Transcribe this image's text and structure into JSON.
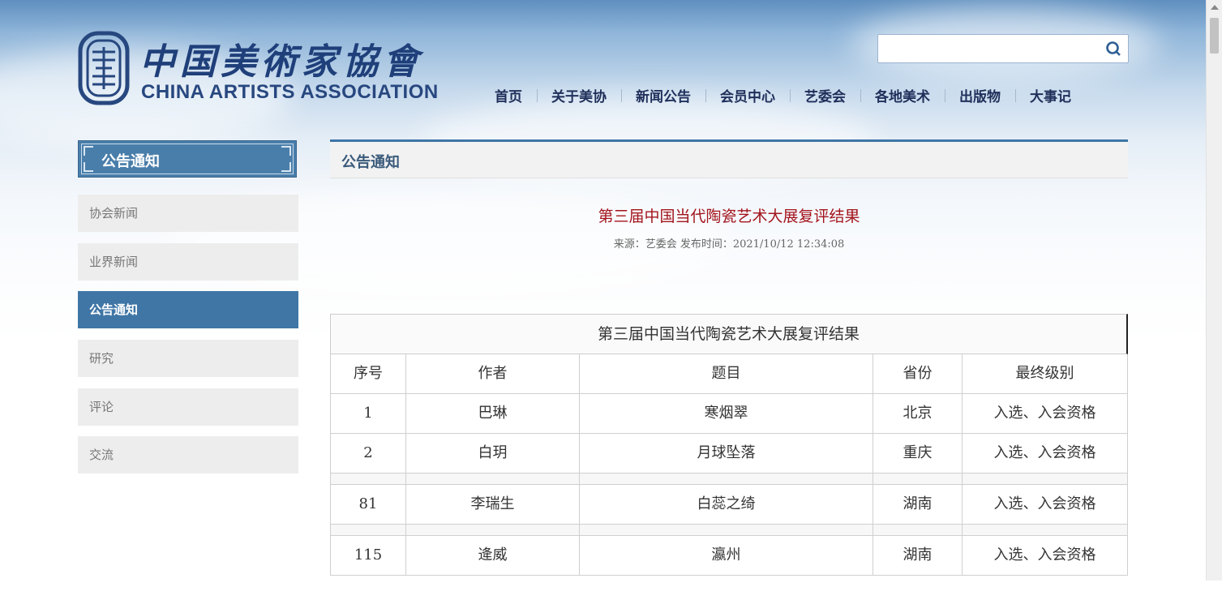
{
  "brand": {
    "name_cn": "中国美術家協會",
    "name_en": "CHINA ARTISTS ASSOCIATION"
  },
  "search": {
    "placeholder": ""
  },
  "nav": [
    "首页",
    "关于美协",
    "新闻公告",
    "会员中心",
    "艺委会",
    "各地美术",
    "出版物",
    "大事记"
  ],
  "sidebar": {
    "title": "公告通知",
    "items": [
      {
        "label": "协会新闻",
        "active": false
      },
      {
        "label": "业界新闻",
        "active": false
      },
      {
        "label": "公告通知",
        "active": true
      },
      {
        "label": "研究",
        "active": false
      },
      {
        "label": "评论",
        "active": false
      },
      {
        "label": "交流",
        "active": false
      }
    ]
  },
  "content": {
    "section_title": "公告通知",
    "article_title": "第三届中国当代陶瓷艺术大展复评结果",
    "meta": "来源：艺委会  发布时间：2021/10/12 12:34:08"
  },
  "table": {
    "caption": "第三届中国当代陶瓷艺术大展复评结果",
    "headers": [
      "序号",
      "作者",
      "题目",
      "省份",
      "最终级别"
    ],
    "rows": [
      [
        "1",
        "巴琳",
        "寒烟翠",
        "北京",
        "入选、入会资格"
      ],
      [
        "2",
        "白玥",
        "月球坠落",
        "重庆",
        "入选、入会资格"
      ],
      [
        "81",
        "李瑞生",
        "白蕊之绮",
        "湖南",
        "入选、入会资格"
      ],
      [
        "115",
        "逄威",
        "瀛州",
        "湖南",
        "入选、入会资格"
      ]
    ]
  },
  "colors": {
    "accent": "#3f76a6",
    "title_red": "#a3141c",
    "nav_text": "#1f2f5a"
  }
}
